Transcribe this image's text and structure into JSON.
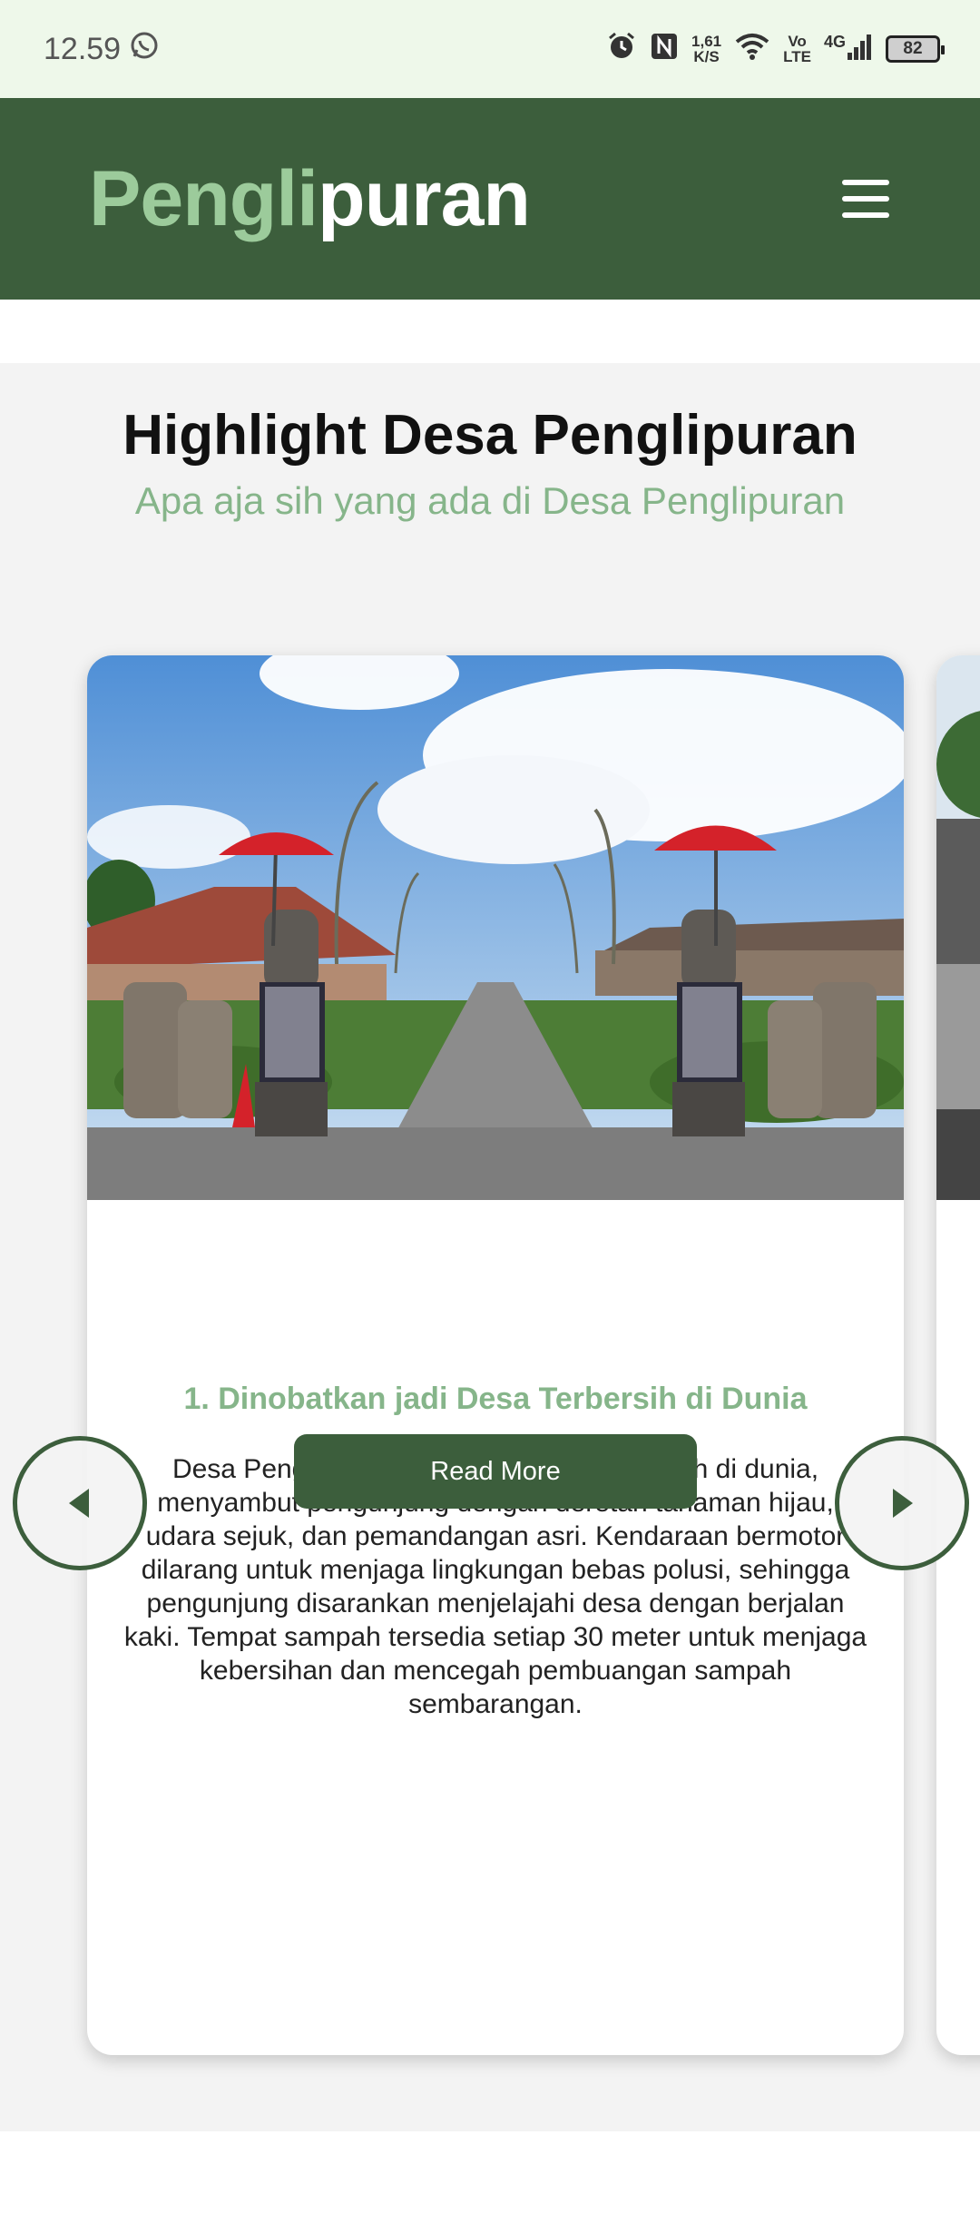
{
  "status_bar": {
    "time": "12.59",
    "speed_value": "1,61",
    "speed_unit": "K/S",
    "volte_top": "Vo",
    "volte_bottom": "LTE",
    "network": "4G",
    "battery": "82"
  },
  "header": {
    "logo_part1": "Pengli",
    "logo_part2": "puran"
  },
  "highlight": {
    "title": "Highlight Desa Penglipuran",
    "subtitle": "Apa aja sih yang ada di Desa Penglipuran"
  },
  "card": {
    "title": "1. Dinobatkan jadi Desa Terbersih di Dunia",
    "text": "Desa Penglipuran, salah satu desa terbersih di dunia, menyambut pengunjung dengan deretan tanaman hijau, udara sejuk, dan pemandangan asri. Kendaraan bermotor dilarang untuk menjaga lingkungan bebas polusi, sehingga pengunjung disarankan menjelajahi desa dengan berjalan kaki. Tempat sampah tersedia setiap 30 meter untuk menjaga kebersihan dan mencegah pembuangan sampah sembarangan.",
    "button": "Read More"
  },
  "colors": {
    "brand_green": "#3c5e3c",
    "accent_light_green": "#86b58a",
    "status_bar_bg": "#eef8ea"
  },
  "icons": {
    "whatsapp": "whatsapp-icon",
    "alarm": "alarm-icon",
    "nfc": "nfc-icon",
    "wifi": "wifi-icon",
    "signal": "signal-icon",
    "menu": "hamburger-menu-icon",
    "prev": "chevron-left-icon",
    "next": "chevron-right-icon"
  }
}
